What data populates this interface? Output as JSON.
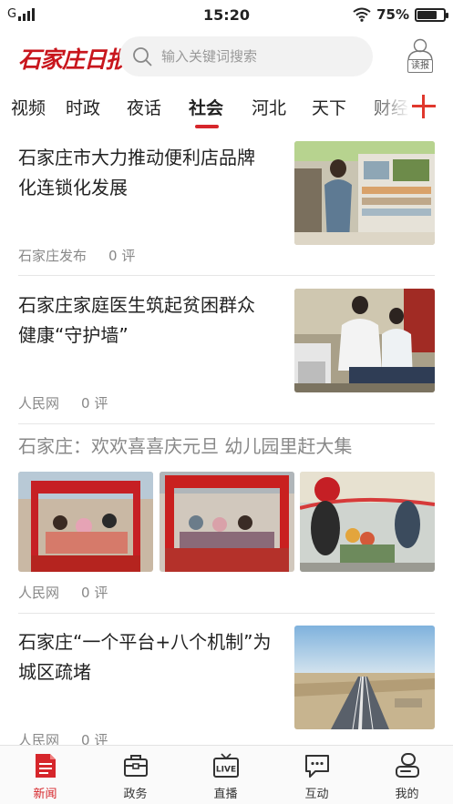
{
  "status_bar": {
    "carrier": "G",
    "time": "15:20",
    "battery_percent": "75%",
    "battery_level": 0.75
  },
  "header": {
    "logo_text": "石家庄日报",
    "search_placeholder": "输入关键词搜索",
    "reader_label": "读报"
  },
  "tabs": [
    {
      "label": "视频"
    },
    {
      "label": "时政"
    },
    {
      "label": "夜话"
    },
    {
      "label": "社会"
    },
    {
      "label": "河北"
    },
    {
      "label": "天下"
    },
    {
      "label": "财经"
    }
  ],
  "active_tab": "社会",
  "news": [
    {
      "title_line1": "石家庄市大力推动便利店品牌",
      "title_line2": "化连锁化发展",
      "source": "石家庄发布",
      "comments": "0 评"
    },
    {
      "title_line1": "石家庄家庭医生筑起贫困群众",
      "title_line2": "健康“守护墙”",
      "source": "人民网",
      "comments": "0 评"
    },
    {
      "title_line1": "石家庄：欢欢喜喜庆元旦 幼儿园里赶大集",
      "source": "人民网",
      "comments": "0 评"
    },
    {
      "title_line1": "石家庄“一个平台+八个机制”为",
      "title_line2": "城区疏堵",
      "source": "人民网",
      "comments": "0 评"
    }
  ],
  "bottom_nav": [
    {
      "label": "新闻",
      "icon": "news-icon"
    },
    {
      "label": "政务",
      "icon": "briefcase-icon"
    },
    {
      "label": "直播",
      "icon": "live-tv-icon"
    },
    {
      "label": "互动",
      "icon": "chat-icon"
    },
    {
      "label": "我的",
      "icon": "profile-icon"
    }
  ],
  "live_badge": "LIVE",
  "colors": {
    "accent": "#d6262b",
    "logo": "#c8161d",
    "text": "#222222",
    "muted": "#888888"
  }
}
